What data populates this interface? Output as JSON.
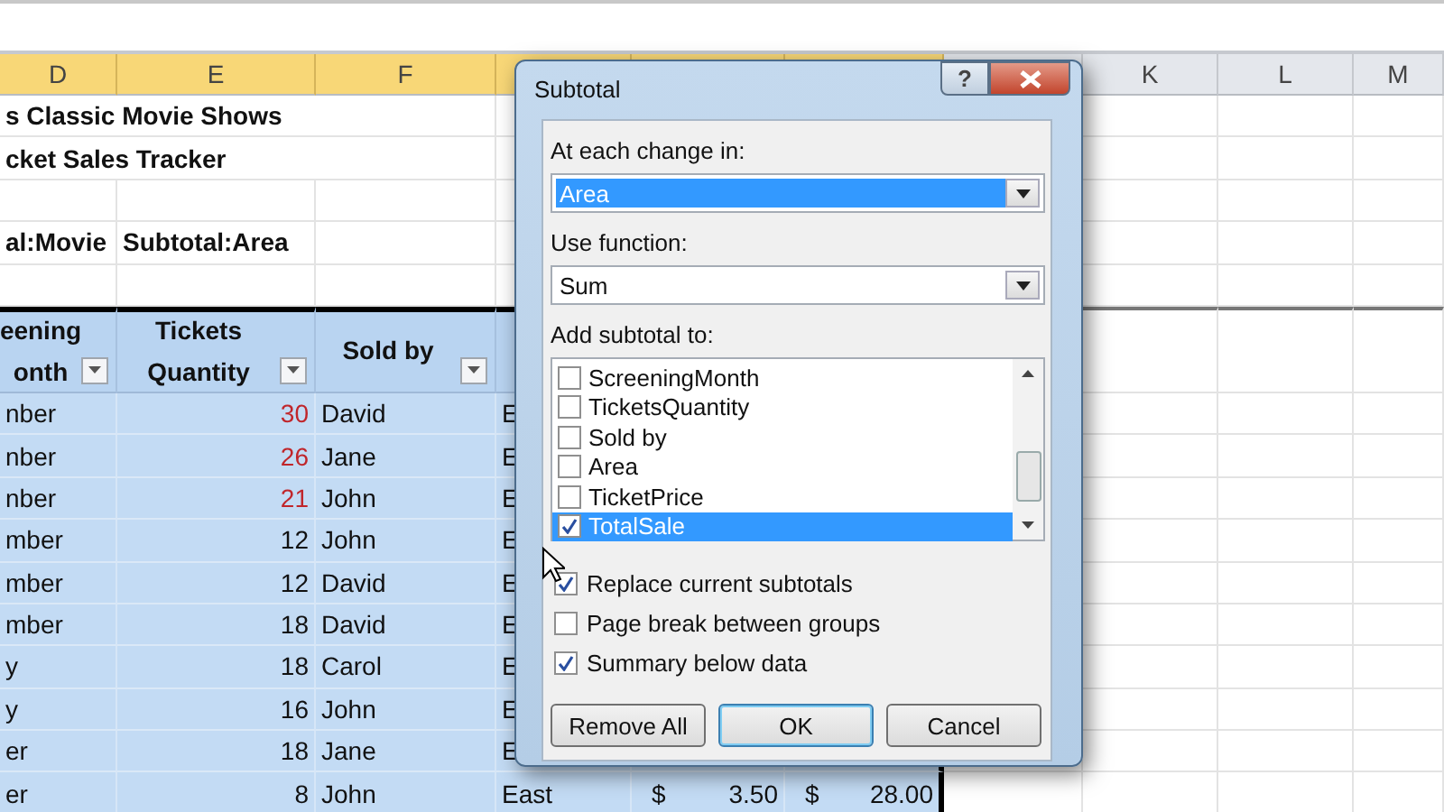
{
  "sheet": {
    "columns": [
      {
        "label": "D",
        "selected": true
      },
      {
        "label": "E",
        "selected": true
      },
      {
        "label": "F",
        "selected": true
      },
      {
        "selected": true
      },
      {
        "selected": true
      },
      {
        "selected": true
      },
      {
        "selected": false
      },
      {
        "label": "K",
        "selected": false
      },
      {
        "label": "L",
        "selected": false
      },
      {
        "label": "M",
        "selected": false
      }
    ],
    "title_rows": [
      {
        "column_d": "s Classic Movie Shows"
      },
      {
        "column_d": "cket Sales Tracker"
      },
      {},
      {
        "column_d": "al:Movie",
        "column_e": "Subtotal:Area"
      },
      {}
    ],
    "table_headers": [
      {
        "label": "eening\nonth",
        "filter": true
      },
      {
        "label": "Tickets\nQuantity",
        "filter": true
      },
      {
        "label": "Sold by",
        "filter": true
      }
    ],
    "rows": [
      {
        "month": "nber",
        "quantity": "30",
        "flagged": true,
        "sold_by": "David",
        "area": "E"
      },
      {
        "month": "nber",
        "quantity": "26",
        "flagged": true,
        "sold_by": "Jane",
        "area": "E"
      },
      {
        "month": "nber",
        "quantity": "21",
        "flagged": true,
        "sold_by": "John",
        "area": "E"
      },
      {
        "month": "mber",
        "quantity": "12",
        "flagged": false,
        "sold_by": "John",
        "area": "E"
      },
      {
        "month": "mber",
        "quantity": "12",
        "flagged": false,
        "sold_by": "David",
        "area": "E"
      },
      {
        "month": "mber",
        "quantity": "18",
        "flagged": false,
        "sold_by": "David",
        "area": "E"
      },
      {
        "month": "y",
        "quantity": "18",
        "flagged": false,
        "sold_by": "Carol",
        "area": "E"
      },
      {
        "month": "y",
        "quantity": "16",
        "flagged": false,
        "sold_by": "John",
        "area": "E"
      },
      {
        "month": "er",
        "quantity": "18",
        "flagged": false,
        "sold_by": "Jane",
        "area": "E"
      },
      {
        "month": "er",
        "quantity": "8",
        "flagged": false,
        "sold_by": "John",
        "area": "East",
        "price_currency": "$",
        "price": "3.50",
        "total_currency": "$",
        "total": "28.00"
      }
    ]
  },
  "dialog": {
    "title": "Subtotal",
    "help_button": "?",
    "change_label": "At each change in:",
    "change_value": "Area",
    "function_label": "Use function:",
    "function_value": "Sum",
    "add_label": "Add subtotal to:",
    "fields": [
      {
        "label": "ScreeningMonth",
        "checked": false,
        "selected": false
      },
      {
        "label": "TicketsQuantity",
        "checked": false,
        "selected": false
      },
      {
        "label": "Sold by",
        "checked": false,
        "selected": false
      },
      {
        "label": "Area",
        "checked": false,
        "selected": false
      },
      {
        "label": "TicketPrice",
        "checked": false,
        "selected": false
      },
      {
        "label": "TotalSale",
        "checked": true,
        "selected": true
      }
    ],
    "options": [
      {
        "label": "Replace current subtotals",
        "checked": true
      },
      {
        "label": "Page break between groups",
        "checked": false
      },
      {
        "label": "Summary below data",
        "checked": true
      }
    ],
    "buttons": [
      {
        "label": "Remove All",
        "default": false
      },
      {
        "label": "OK",
        "default": true
      },
      {
        "label": "Cancel",
        "default": false
      }
    ]
  }
}
